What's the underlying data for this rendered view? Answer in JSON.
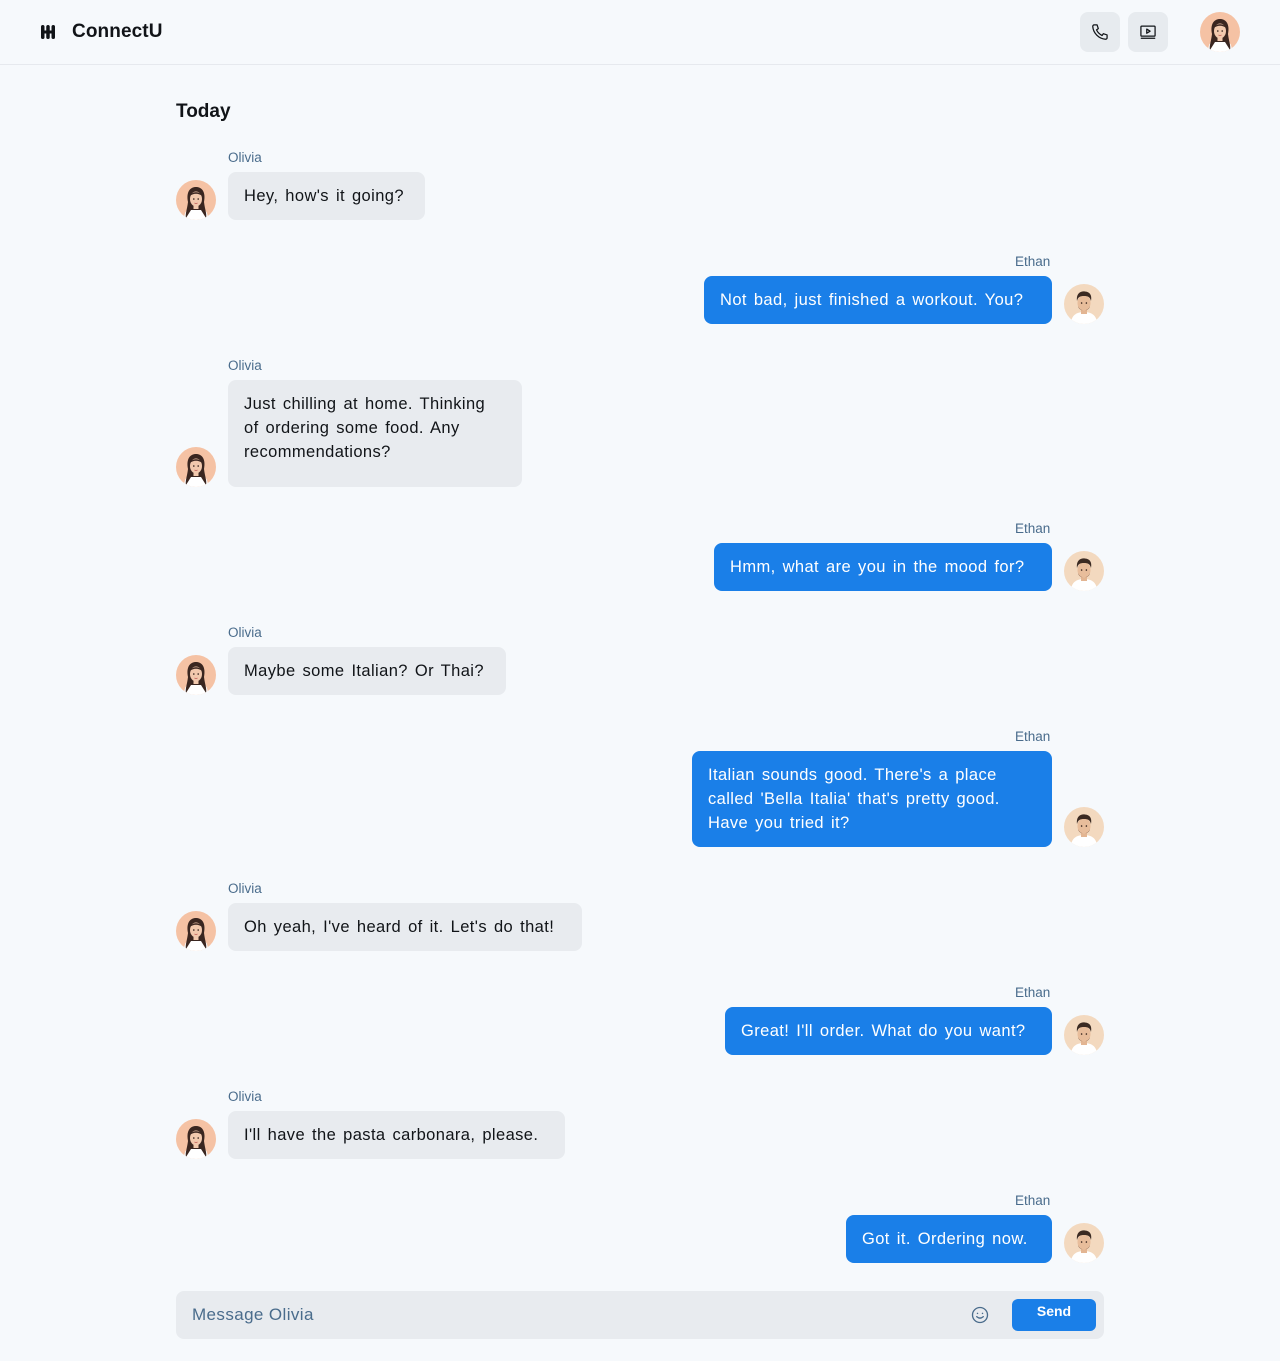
{
  "app": {
    "name": "ConnectU",
    "logo_icon": "connectu-logo-icon"
  },
  "header": {
    "call_icon": "phone-icon",
    "video_icon": "video-icon"
  },
  "chat": {
    "day_label": "Today",
    "messages": [
      {
        "sender": "Olivia",
        "text": "Hey, how's it going?",
        "direction": "incoming"
      },
      {
        "sender": "Ethan",
        "text": "Not bad, just finished a workout. You?",
        "direction": "outgoing"
      },
      {
        "sender": "Olivia",
        "text": "Just chilling at home. Thinking of ordering some food. Any recommendations?",
        "direction": "incoming"
      },
      {
        "sender": "Ethan",
        "text": "Hmm, what are you in the mood for?",
        "direction": "outgoing"
      },
      {
        "sender": "Olivia",
        "text": "Maybe some Italian? Or Thai?",
        "direction": "incoming"
      },
      {
        "sender": "Ethan",
        "text": "Italian sounds good. There's a place called 'Bella Italia' that's pretty good. Have you tried it?",
        "direction": "outgoing"
      },
      {
        "sender": "Olivia",
        "text": "Oh yeah, I've heard of it. Let's do that!",
        "direction": "incoming"
      },
      {
        "sender": "Ethan",
        "text": "Great! I'll order. What do you want?",
        "direction": "outgoing"
      },
      {
        "sender": "Olivia",
        "text": "I'll have the pasta carbonara, please.",
        "direction": "incoming"
      },
      {
        "sender": "Ethan",
        "text": "Got it. Ordering now.",
        "direction": "outgoing"
      }
    ]
  },
  "composer": {
    "placeholder": "Message Olivia",
    "value": "",
    "emoji_icon": "smiley-icon",
    "send_label": "Send"
  },
  "colors": {
    "background": "#f6f9fc",
    "accent": "#1a7fe8",
    "incoming_bubble": "#e8ebef",
    "sender_label": "#4a6c8c"
  }
}
